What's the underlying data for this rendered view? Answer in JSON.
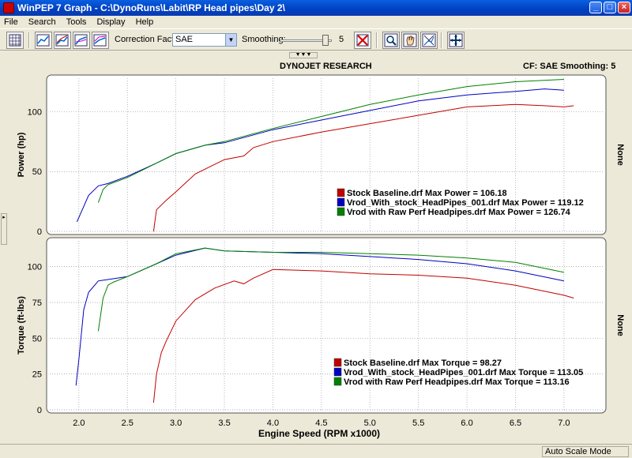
{
  "window": {
    "title": "WinPEP 7    Graph - C:\\DynoRuns\\Labit\\RP Head pipes\\Day 2\\",
    "minimize_label": "_",
    "maximize_label": "□",
    "close_label": "×"
  },
  "menu": [
    "File",
    "Search",
    "Tools",
    "Display",
    "Help"
  ],
  "toolbar": {
    "correction_label": "Correction Factor:",
    "correction_value": "SAE",
    "smoothing_label": "Smoothing:",
    "smoothing_value": "5",
    "smoothing_level_fraction": 0.9,
    "icons": [
      "grid-icon",
      "graph-options-icon",
      "graph-1-icon",
      "graph-2-icon",
      "graph-3-icon",
      "delete-run-icon",
      "zoom-icon",
      "pan-hand-icon",
      "scale-icon",
      "crosshair-icon"
    ]
  },
  "header": {
    "center": "DYNOJET RESEARCH",
    "right": "CF: SAE  Smoothing: 5"
  },
  "status": {
    "mode": "Auto Scale Mode"
  },
  "chart_data": [
    {
      "type": "line",
      "ylabel": "Power (hp)",
      "right_label": "None",
      "ylim": [
        0,
        128
      ],
      "yticks": [
        0,
        50,
        100
      ],
      "xlim": [
        1.7,
        7.4
      ],
      "series": [
        {
          "name": "Stock Baseline.drf Max Power = 106.18",
          "color": "#c00000",
          "x": [
            2.77,
            2.8,
            2.9,
            3.0,
            3.2,
            3.5,
            3.7,
            3.8,
            4.0,
            4.5,
            5.0,
            5.5,
            6.0,
            6.5,
            6.8,
            7.0,
            7.1
          ],
          "y": [
            0,
            18,
            26,
            33,
            48,
            60,
            63,
            70,
            75,
            83,
            90,
            97,
            104,
            106,
            105,
            104,
            105
          ]
        },
        {
          "name": "Vrod_With_stock_HeadPipes_001.drf Max Power = 119.12",
          "color": "#0000c0",
          "x": [
            1.98,
            2.1,
            2.2,
            2.3,
            2.5,
            2.8,
            3.0,
            3.3,
            3.5,
            4.0,
            4.5,
            5.0,
            5.5,
            6.0,
            6.5,
            6.8,
            7.0
          ],
          "y": [
            8,
            30,
            38,
            40,
            46,
            57,
            65,
            72,
            74,
            85,
            93,
            101,
            109,
            114,
            117,
            119,
            118
          ]
        },
        {
          "name": "Vrod with Raw Perf Headpipes.drf Max Power = 126.74",
          "color": "#008000",
          "x": [
            2.2,
            2.25,
            2.3,
            2.5,
            2.8,
            3.0,
            3.3,
            3.5,
            4.0,
            4.5,
            5.0,
            5.5,
            6.0,
            6.5,
            7.0
          ],
          "y": [
            24,
            35,
            39,
            45,
            57,
            65,
            72,
            75,
            86,
            96,
            106,
            114,
            121,
            125,
            127
          ]
        }
      ]
    },
    {
      "type": "line",
      "ylabel": "Torque (ft-lbs)",
      "right_label": "None",
      "xlabel": "Engine Speed (RPM x1000)",
      "ylim": [
        0,
        118
      ],
      "yticks": [
        0,
        25,
        50,
        75,
        100
      ],
      "xticks": [
        2.0,
        2.5,
        3.0,
        3.5,
        4.0,
        4.5,
        5.0,
        5.5,
        6.0,
        6.5,
        7.0
      ],
      "xlim": [
        1.7,
        7.4
      ],
      "series": [
        {
          "name": "Stock Baseline.drf Max Torque = 98.27",
          "color": "#c00000",
          "x": [
            2.77,
            2.8,
            2.85,
            2.9,
            3.0,
            3.2,
            3.4,
            3.6,
            3.7,
            3.8,
            4.0,
            4.5,
            5.0,
            5.5,
            6.0,
            6.5,
            7.0,
            7.1
          ],
          "y": [
            5,
            25,
            40,
            48,
            62,
            77,
            85,
            90,
            88,
            92,
            98,
            97,
            95,
            94,
            92,
            87,
            80,
            78
          ]
        },
        {
          "name": "Vrod_With_stock_HeadPipes_001.drf Max Torque = 113.05",
          "color": "#0000c0",
          "x": [
            1.97,
            2.0,
            2.05,
            2.1,
            2.2,
            2.3,
            2.5,
            2.8,
            3.0,
            3.3,
            3.5,
            4.0,
            4.5,
            5.0,
            5.5,
            6.0,
            6.5,
            7.0
          ],
          "y": [
            17,
            35,
            70,
            82,
            90,
            91,
            93,
            102,
            108,
            113,
            111,
            110,
            109,
            107,
            105,
            102,
            97,
            90
          ]
        },
        {
          "name": "Vrod with Raw Perf Headpipes.drf Max Torque = 113.16",
          "color": "#008000",
          "x": [
            2.2,
            2.25,
            2.3,
            2.35,
            2.5,
            2.8,
            3.0,
            3.3,
            3.5,
            4.0,
            4.5,
            5.0,
            5.5,
            6.0,
            6.5,
            7.0
          ],
          "y": [
            55,
            78,
            87,
            89,
            93,
            102,
            109,
            113,
            111,
            110,
            110,
            109,
            108,
            106,
            103,
            96
          ]
        }
      ]
    }
  ]
}
